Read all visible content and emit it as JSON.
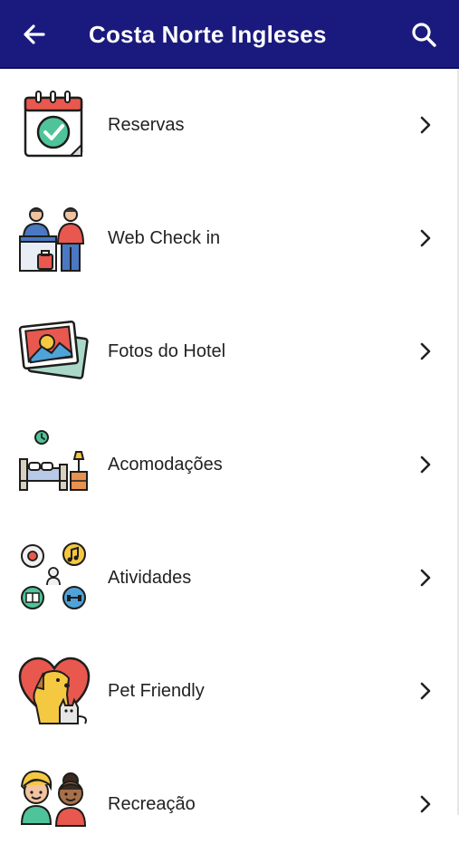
{
  "appbar": {
    "title": "Costa Norte Ingleses",
    "back_icon": "arrow-left-icon",
    "search_icon": "search-icon",
    "background": "#1a1a7e"
  },
  "menu": {
    "items": [
      {
        "label": "Reservas",
        "icon": "calendar-check-icon"
      },
      {
        "label": "Web Check in",
        "icon": "reception-desk-icon"
      },
      {
        "label": "Fotos do Hotel",
        "icon": "photos-icon"
      },
      {
        "label": "Acomodações",
        "icon": "bed-icon"
      },
      {
        "label": "Atividades",
        "icon": "activities-icon"
      },
      {
        "label": "Pet Friendly",
        "icon": "pet-friendly-icon"
      },
      {
        "label": "Recreação",
        "icon": "kids-icon"
      }
    ],
    "chevron_icon": "chevron-right-icon"
  }
}
